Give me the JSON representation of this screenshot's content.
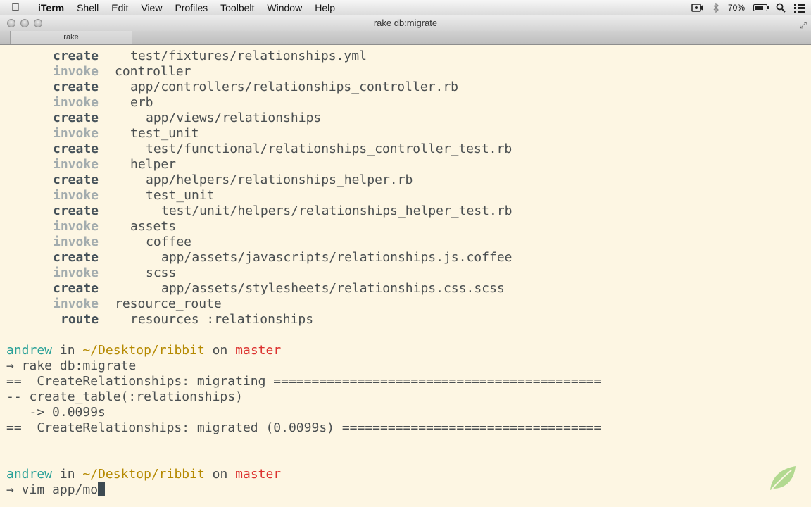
{
  "menubar": {
    "app": "iTerm",
    "items": [
      "Shell",
      "Edit",
      "View",
      "Profiles",
      "Toolbelt",
      "Window",
      "Help"
    ],
    "battery": "70%"
  },
  "window": {
    "title": "rake db:migrate",
    "tab": "rake"
  },
  "generator_lines": [
    {
      "action": "create",
      "path": "test/fixtures/relationships.yml",
      "indent": 1
    },
    {
      "action": "invoke",
      "path": "controller",
      "indent": 0
    },
    {
      "action": "create",
      "path": "app/controllers/relationships_controller.rb",
      "indent": 1
    },
    {
      "action": "invoke",
      "path": "erb",
      "indent": 1
    },
    {
      "action": "create",
      "path": "app/views/relationships",
      "indent": 2
    },
    {
      "action": "invoke",
      "path": "test_unit",
      "indent": 1
    },
    {
      "action": "create",
      "path": "test/functional/relationships_controller_test.rb",
      "indent": 2
    },
    {
      "action": "invoke",
      "path": "helper",
      "indent": 1
    },
    {
      "action": "create",
      "path": "app/helpers/relationships_helper.rb",
      "indent": 2
    },
    {
      "action": "invoke",
      "path": "test_unit",
      "indent": 2
    },
    {
      "action": "create",
      "path": "test/unit/helpers/relationships_helper_test.rb",
      "indent": 3
    },
    {
      "action": "invoke",
      "path": "assets",
      "indent": 1
    },
    {
      "action": "invoke",
      "path": "coffee",
      "indent": 2
    },
    {
      "action": "create",
      "path": "app/assets/javascripts/relationships.js.coffee",
      "indent": 3
    },
    {
      "action": "invoke",
      "path": "scss",
      "indent": 2
    },
    {
      "action": "create",
      "path": "app/assets/stylesheets/relationships.css.scss",
      "indent": 3
    },
    {
      "action": "invoke",
      "path": "resource_route",
      "indent": 0
    },
    {
      "action": "route",
      "path": "resources :relationships",
      "indent": 1
    }
  ],
  "prompt1": {
    "user": "andrew",
    "in": "in",
    "dir": "~/Desktop/ribbit",
    "on": "on",
    "branch": "master",
    "command": "→ rake db:migrate"
  },
  "migration_output": [
    "==  CreateRelationships: migrating ===========================================",
    "-- create_table(:relationships)",
    "   -> 0.0099s",
    "==  CreateRelationships: migrated (0.0099s) =================================="
  ],
  "prompt2": {
    "user": "andrew",
    "in": "in",
    "dir": "~/Desktop/ribbit",
    "on": "on",
    "branch": "master",
    "command": "→ vim app/mo"
  }
}
